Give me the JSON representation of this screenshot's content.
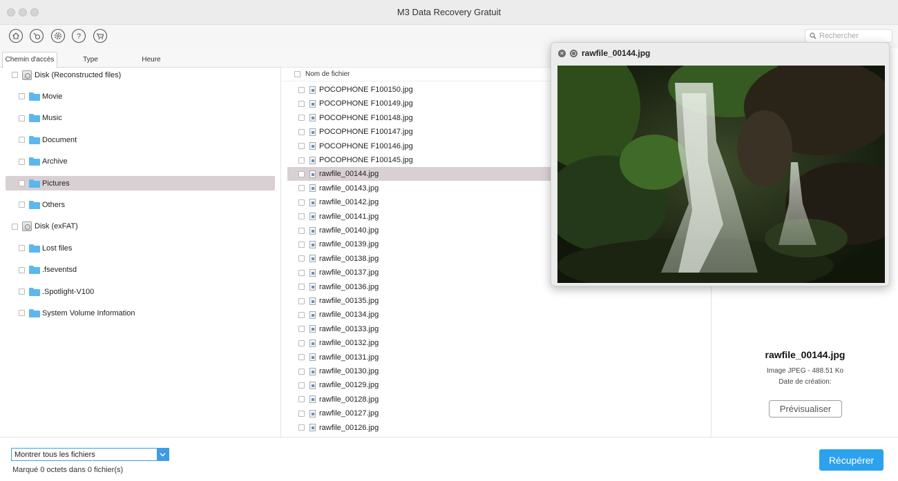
{
  "app": {
    "title": "M3 Data Recovery Gratuit"
  },
  "toolbar": {
    "icons": [
      "home-icon",
      "search-scan-icon",
      "settings-icon",
      "help-icon",
      "cart-icon"
    ],
    "search_placeholder": "Rechercher"
  },
  "tabs": [
    {
      "label": "Chemin d'accès",
      "active": true
    },
    {
      "label": "Type",
      "active": false
    },
    {
      "label": "Heure",
      "active": false
    }
  ],
  "tree": [
    {
      "label": "Disk (Reconstructed files)",
      "kind": "disk",
      "level": 0,
      "selected": false
    },
    {
      "label": "Movie",
      "kind": "folder",
      "level": 1,
      "selected": false
    },
    {
      "label": "Music",
      "kind": "folder",
      "level": 1,
      "selected": false
    },
    {
      "label": "Document",
      "kind": "folder",
      "level": 1,
      "selected": false
    },
    {
      "label": "Archive",
      "kind": "folder",
      "level": 1,
      "selected": false
    },
    {
      "label": "Pictures",
      "kind": "folder",
      "level": 1,
      "selected": true
    },
    {
      "label": "Others",
      "kind": "folder",
      "level": 1,
      "selected": false
    },
    {
      "label": "Disk (exFAT)",
      "kind": "disk",
      "level": 0,
      "selected": false
    },
    {
      "label": "Lost files",
      "kind": "folder",
      "level": 1,
      "selected": false
    },
    {
      "label": ".fseventsd",
      "kind": "folder",
      "level": 1,
      "selected": false
    },
    {
      "label": ".Spotlight-V100",
      "kind": "folder",
      "level": 1,
      "selected": false
    },
    {
      "label": "System Volume Information",
      "kind": "folder",
      "level": 1,
      "selected": false
    }
  ],
  "file_list": {
    "column_header": "Nom de fichier",
    "selected": "rawfile_00144.jpg",
    "files": [
      "POCOPHONE F100150.jpg",
      "POCOPHONE F100149.jpg",
      "POCOPHONE F100148.jpg",
      "POCOPHONE F100147.jpg",
      "POCOPHONE F100146.jpg",
      "POCOPHONE F100145.jpg",
      "rawfile_00144.jpg",
      "rawfile_00143.jpg",
      "rawfile_00142.jpg",
      "rawfile_00141.jpg",
      "rawfile_00140.jpg",
      "rawfile_00139.jpg",
      "rawfile_00138.jpg",
      "rawfile_00137.jpg",
      "rawfile_00136.jpg",
      "rawfile_00135.jpg",
      "rawfile_00134.jpg",
      "rawfile_00133.jpg",
      "rawfile_00132.jpg",
      "rawfile_00131.jpg",
      "rawfile_00130.jpg",
      "rawfile_00129.jpg",
      "rawfile_00128.jpg",
      "rawfile_00127.jpg",
      "rawfile_00126.jpg"
    ]
  },
  "preview_popup": {
    "title": "rawfile_00144.jpg"
  },
  "info": {
    "name": "rawfile_00144.jpg",
    "type_size": "Image JPEG - 488.51 Ko",
    "date_label": "Date de création:",
    "preview_button": "Prévisualiser"
  },
  "bottom": {
    "filter_value": "Montrer tous les fichiers",
    "status": "Marqué 0 octets dans 0 fichier(s)",
    "recover_button": "Récupérer"
  },
  "colors": {
    "accent": "#2ca2ee",
    "selection": "#d9d0d3",
    "folder": "#5cb7ee"
  }
}
